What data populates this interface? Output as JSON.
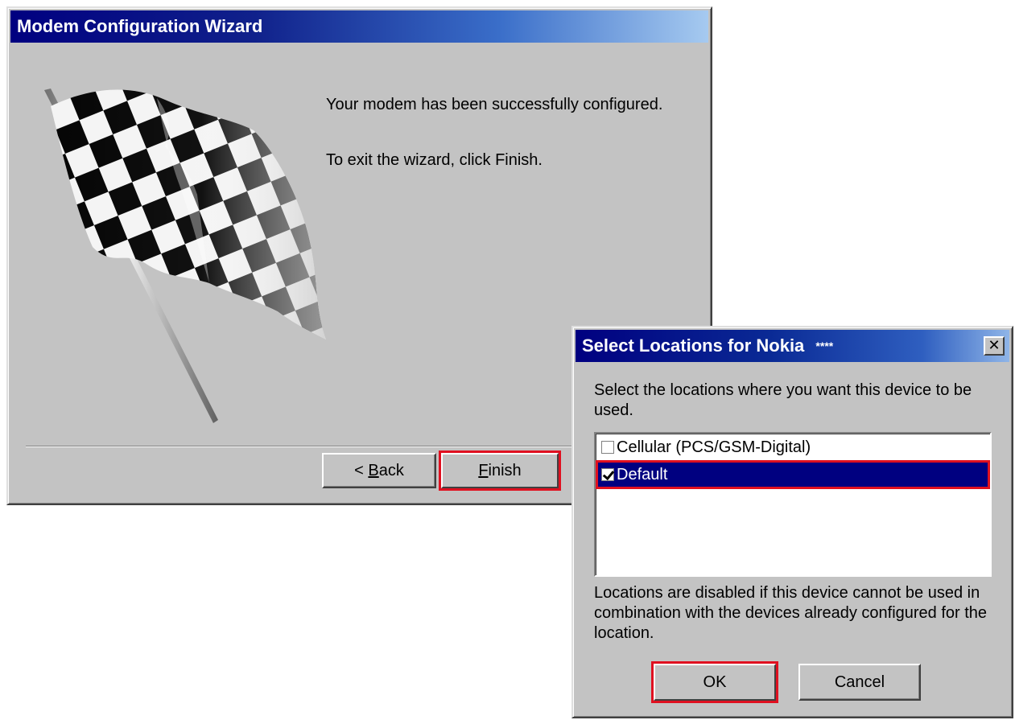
{
  "wizard": {
    "title": "Modem Configuration Wizard",
    "message1": "Your modem has been successfully configured.",
    "message2": "To exit the wizard, click Finish.",
    "back_prefix": "< ",
    "back_key": "B",
    "back_rest": "ack",
    "finish_key": "F",
    "finish_rest": "inish"
  },
  "locations": {
    "title": "Select Locations for Nokia",
    "title_suffix": "****",
    "close_glyph": "✕",
    "instruction": "Select the locations where you want this device to be used.",
    "items": [
      {
        "label": "Cellular (PCS/GSM-Digital)",
        "checked": false,
        "selected": false
      },
      {
        "label": "Default",
        "checked": true,
        "selected": true
      }
    ],
    "note": "Locations are disabled if this device cannot be used in combination with the devices already configured for the location.",
    "ok_label": "OK",
    "cancel_label": "Cancel"
  },
  "colors": {
    "face": "#c3c3c3",
    "title_start": "#000080",
    "title_end": "#a6caf0",
    "highlight": "#e01020"
  },
  "icons": {
    "flag": "checkered-flag-icon",
    "close": "close-icon",
    "checkbox": "checkbox-icon"
  }
}
